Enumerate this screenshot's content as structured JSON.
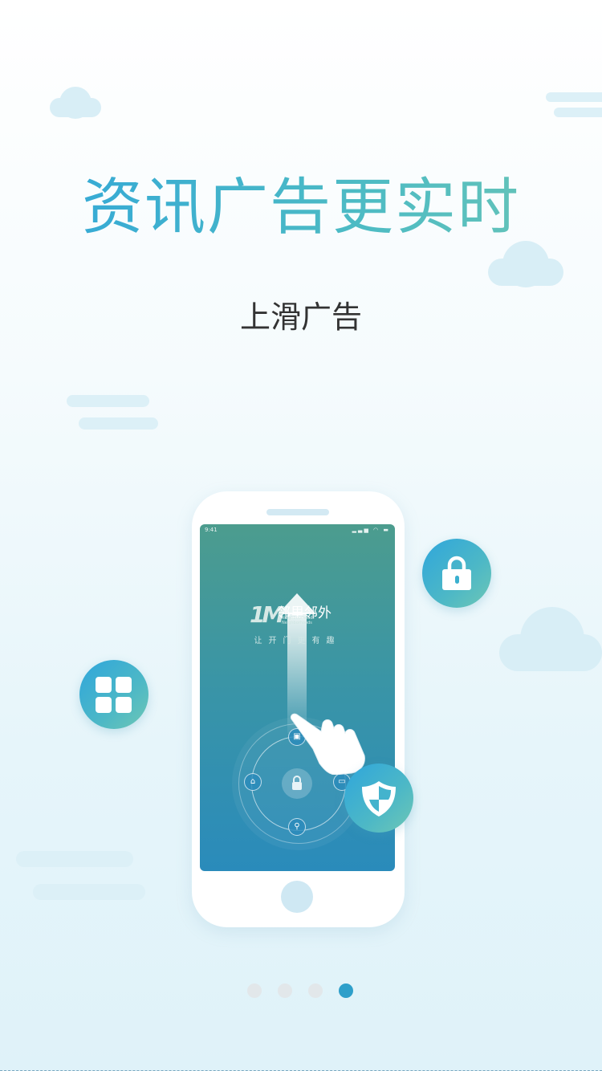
{
  "headline": "资讯广告更实时",
  "subheadline": "上滑广告",
  "phone_screen": {
    "status_time": "9:41",
    "status_icons": "▂▃▅ ◠ ▬",
    "logo_mark": "1M",
    "logo_cn": "邻里邻外",
    "logo_en": "Neighbourhood · Neighborhoods",
    "tagline": "让开门更有趣"
  },
  "feature_icons": [
    "lock-icon",
    "apps-grid-icon",
    "shield-icon",
    "pointing-hand-icon"
  ],
  "pagination": {
    "total": 4,
    "active_index": 3
  },
  "colors": {
    "accent_start": "#31a6d9",
    "accent_end": "#6cc6b5",
    "dot_inactive": "#e2e7ea",
    "dot_active": "#2e9fca"
  }
}
